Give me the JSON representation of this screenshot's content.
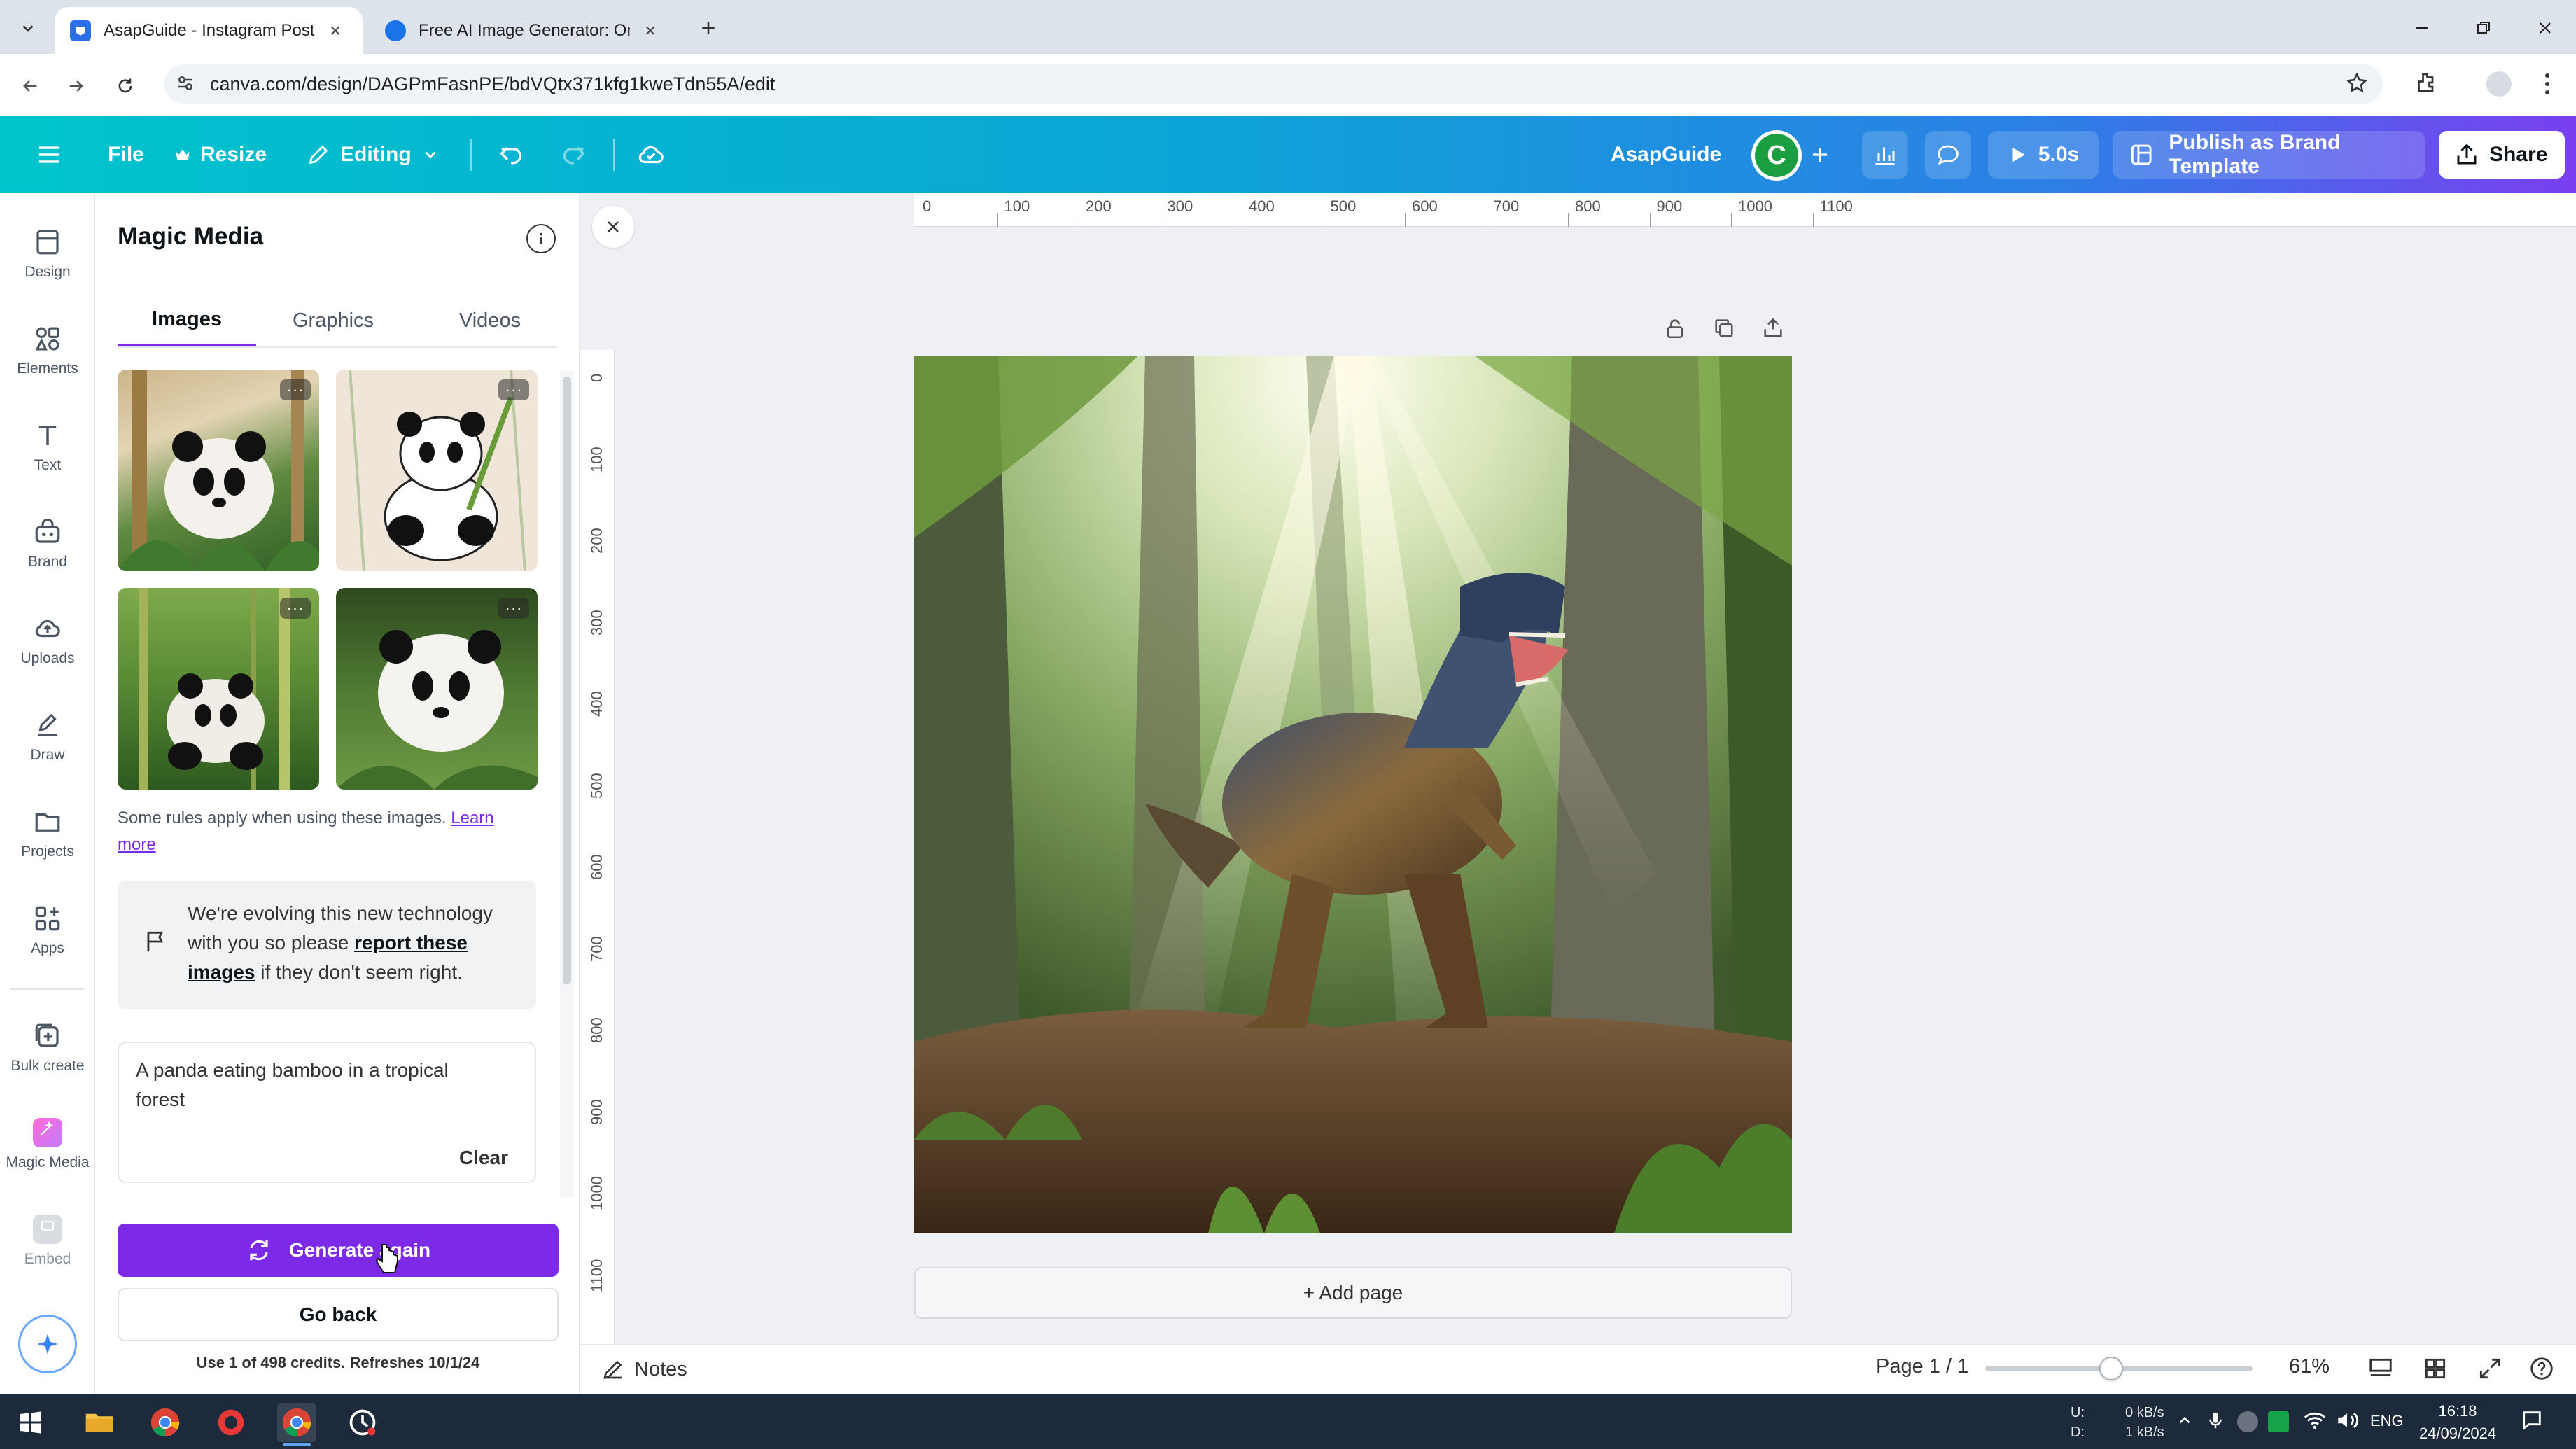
{
  "browser": {
    "tabs": [
      {
        "title": "AsapGuide - Instagram Post",
        "active": true
      },
      {
        "title": "Free AI Image Generator: Onlin",
        "active": false
      }
    ],
    "url": "canva.com/design/DAGPmFasnPE/bdVQtx371kfg1kweTdn55A/edit"
  },
  "topbar": {
    "file": "File",
    "resize": "Resize",
    "editing": "Editing",
    "project_name": "AsapGuide",
    "avatar_initial": "C",
    "play_time": "5.0s",
    "publish": "Publish as Brand Template",
    "share": "Share"
  },
  "rail": {
    "items": [
      {
        "label": "Design",
        "icon": "design-icon"
      },
      {
        "label": "Elements",
        "icon": "elements-icon"
      },
      {
        "label": "Text",
        "icon": "text-icon"
      },
      {
        "label": "Brand",
        "icon": "brand-icon"
      },
      {
        "label": "Uploads",
        "icon": "uploads-icon"
      },
      {
        "label": "Draw",
        "icon": "draw-icon"
      },
      {
        "label": "Projects",
        "icon": "projects-icon"
      },
      {
        "label": "Apps",
        "icon": "apps-icon"
      },
      {
        "label": "Bulk create",
        "icon": "bulk-create-icon"
      },
      {
        "label": "Magic Media",
        "icon": "magic-media-icon"
      },
      {
        "label": "Embed",
        "icon": "embed-icon"
      }
    ]
  },
  "panel": {
    "title": "Magic Media",
    "tabs": [
      "Images",
      "Graphics",
      "Videos"
    ],
    "active_tab": "Images",
    "thumbnail_more": "···",
    "rules_text": "Some rules apply when using these images.",
    "learn_more": "Learn more",
    "notice_prefix": "We're evolving this new technology with you so please",
    "notice_link": "report these images",
    "notice_suffix": "if they don't seem right.",
    "prompt": "A panda eating bamboo in a tropical forest",
    "clear": "Clear",
    "generate_again": "Generate again",
    "go_back": "Go back",
    "credits": "Use 1 of 498 credits. Refreshes 10/1/24"
  },
  "canvas": {
    "ruler_h": [
      "0",
      "100",
      "200",
      "300",
      "400",
      "500",
      "600",
      "700",
      "800",
      "900",
      "1000",
      "1100"
    ],
    "ruler_v": [
      "0",
      "100",
      "200",
      "300",
      "400",
      "500",
      "600",
      "700",
      "800",
      "900",
      "1000",
      "1100"
    ],
    "add_page": "+ Add page"
  },
  "footer": {
    "notes": "Notes",
    "page": "Page 1 / 1",
    "zoom": "61%",
    "zoom_level": 0.47
  },
  "taskbar": {
    "net_up_label": "U:",
    "net_down_label": "D:",
    "net_up": "0 kB/s",
    "net_down": "1 kB/s",
    "lang": "ENG",
    "time": "16:18",
    "date": "24/09/2024"
  },
  "colors": {
    "accent": "#7d2ae8",
    "teal": "#00c4cc",
    "avatar": "#1a9e3f"
  }
}
